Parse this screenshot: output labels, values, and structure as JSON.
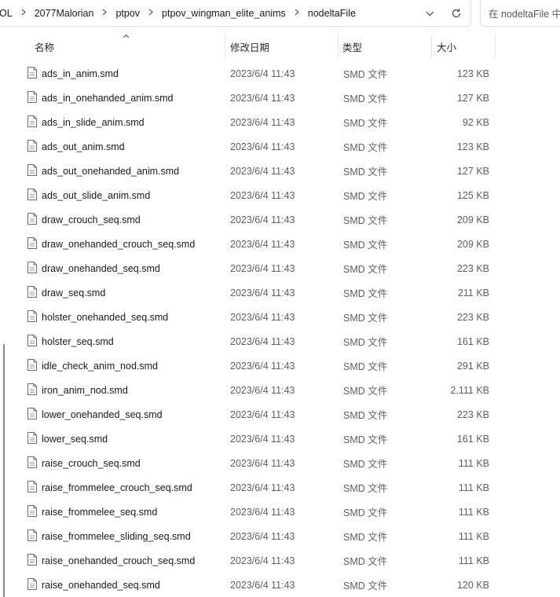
{
  "address": {
    "crumbs": [
      "OL",
      "2077Malorian",
      "ptpov",
      "ptpov_wingman_elite_anims",
      "nodeltaFile"
    ],
    "separator_icon": "chevron-right-icon",
    "dropdown_icon": "chevron-down-icon",
    "refresh_icon": "refresh-icon"
  },
  "search": {
    "placeholder": "在 nodeltaFile 中"
  },
  "columns": {
    "name": "名称",
    "date": "修改日期",
    "type": "类型",
    "size": "大小"
  },
  "files": [
    {
      "name": "ads_in_anim.smd",
      "date": "2023/6/4 11:43",
      "type": "SMD 文件",
      "size": "123 KB"
    },
    {
      "name": "ads_in_onehanded_anim.smd",
      "date": "2023/6/4 11:43",
      "type": "SMD 文件",
      "size": "127 KB"
    },
    {
      "name": "ads_in_slide_anim.smd",
      "date": "2023/6/4 11:43",
      "type": "SMD 文件",
      "size": "92 KB"
    },
    {
      "name": "ads_out_anim.smd",
      "date": "2023/6/4 11:43",
      "type": "SMD 文件",
      "size": "123 KB"
    },
    {
      "name": "ads_out_onehanded_anim.smd",
      "date": "2023/6/4 11:43",
      "type": "SMD 文件",
      "size": "127 KB"
    },
    {
      "name": "ads_out_slide_anim.smd",
      "date": "2023/6/4 11:43",
      "type": "SMD 文件",
      "size": "125 KB"
    },
    {
      "name": "draw_crouch_seq.smd",
      "date": "2023/6/4 11:43",
      "type": "SMD 文件",
      "size": "209 KB"
    },
    {
      "name": "draw_onehanded_crouch_seq.smd",
      "date": "2023/6/4 11:43",
      "type": "SMD 文件",
      "size": "209 KB"
    },
    {
      "name": "draw_onehanded_seq.smd",
      "date": "2023/6/4 11:43",
      "type": "SMD 文件",
      "size": "223 KB"
    },
    {
      "name": "draw_seq.smd",
      "date": "2023/6/4 11:43",
      "type": "SMD 文件",
      "size": "211 KB"
    },
    {
      "name": "holster_onehanded_seq.smd",
      "date": "2023/6/4 11:43",
      "type": "SMD 文件",
      "size": "223 KB"
    },
    {
      "name": "holster_seq.smd",
      "date": "2023/6/4 11:43",
      "type": "SMD 文件",
      "size": "161 KB"
    },
    {
      "name": "idle_check_anim_nod.smd",
      "date": "2023/6/4 11:43",
      "type": "SMD 文件",
      "size": "291 KB"
    },
    {
      "name": "iron_anim_nod.smd",
      "date": "2023/6/4 11:43",
      "type": "SMD 文件",
      "size": "2,111 KB"
    },
    {
      "name": "lower_onehanded_seq.smd",
      "date": "2023/6/4 11:43",
      "type": "SMD 文件",
      "size": "223 KB"
    },
    {
      "name": "lower_seq.smd",
      "date": "2023/6/4 11:43",
      "type": "SMD 文件",
      "size": "161 KB"
    },
    {
      "name": "raise_crouch_seq.smd",
      "date": "2023/6/4 11:43",
      "type": "SMD 文件",
      "size": "111 KB"
    },
    {
      "name": "raise_frommelee_crouch_seq.smd",
      "date": "2023/6/4 11:43",
      "type": "SMD 文件",
      "size": "111 KB"
    },
    {
      "name": "raise_frommelee_seq.smd",
      "date": "2023/6/4 11:43",
      "type": "SMD 文件",
      "size": "111 KB"
    },
    {
      "name": "raise_frommelee_sliding_seq.smd",
      "date": "2023/6/4 11:43",
      "type": "SMD 文件",
      "size": "111 KB"
    },
    {
      "name": "raise_onehanded_crouch_seq.smd",
      "date": "2023/6/4 11:43",
      "type": "SMD 文件",
      "size": "111 KB"
    },
    {
      "name": "raise_onehanded_seq.smd",
      "date": "2023/6/4 11:43",
      "type": "SMD 文件",
      "size": "120 KB"
    }
  ],
  "file_icon": "file-icon",
  "sort_icon": "sort-ascending-icon"
}
